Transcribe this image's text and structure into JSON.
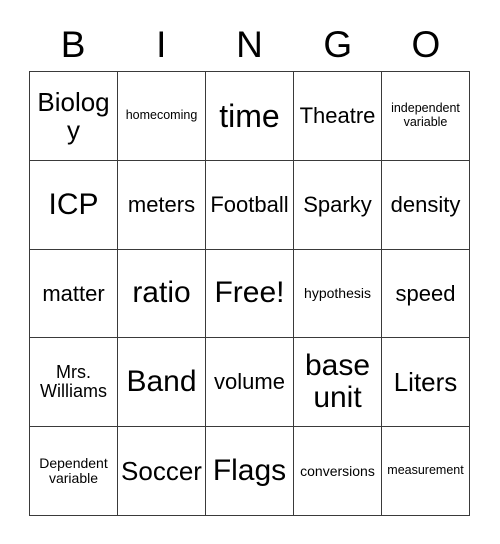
{
  "card": {
    "header": {
      "letters": [
        "B",
        "I",
        "N",
        "G",
        "O"
      ]
    },
    "grid": {
      "rows": 5,
      "columns": 5,
      "free_space": {
        "row": 2,
        "column": 2,
        "label": "Free!"
      },
      "cells": [
        [
          {
            "text": "Biology",
            "size": "lg"
          },
          {
            "text": "homecoming",
            "size": "xxs"
          },
          {
            "text": "time",
            "size": "xxl"
          },
          {
            "text": "Theatre",
            "size": "md"
          },
          {
            "text": "independent\nvariable",
            "size": "xxs"
          }
        ],
        [
          {
            "text": "ICP",
            "size": "xl"
          },
          {
            "text": "meters",
            "size": "md"
          },
          {
            "text": "Football",
            "size": "md"
          },
          {
            "text": "Sparky",
            "size": "md"
          },
          {
            "text": "density",
            "size": "md"
          }
        ],
        [
          {
            "text": "matter",
            "size": "md"
          },
          {
            "text": "ratio",
            "size": "xl"
          },
          {
            "text": "Free!",
            "size": "xl"
          },
          {
            "text": "hypothesis",
            "size": "xs"
          },
          {
            "text": "speed",
            "size": "md"
          }
        ],
        [
          {
            "text": "Mrs.\nWilliams",
            "size": "sm"
          },
          {
            "text": "Band",
            "size": "xl"
          },
          {
            "text": "volume",
            "size": "md"
          },
          {
            "text": "base\nunit",
            "size": "xl"
          },
          {
            "text": "Liters",
            "size": "lg"
          }
        ],
        [
          {
            "text": "Dependent\nvariable",
            "size": "xs"
          },
          {
            "text": "Soccer",
            "size": "lg"
          },
          {
            "text": "Flags",
            "size": "xl"
          },
          {
            "text": "conversions",
            "size": "xs"
          },
          {
            "text": "measurement",
            "size": "xxs"
          }
        ]
      ]
    },
    "colors": {
      "background": "#ffffff",
      "text": "#000000",
      "border": "#3a3a3a"
    }
  }
}
